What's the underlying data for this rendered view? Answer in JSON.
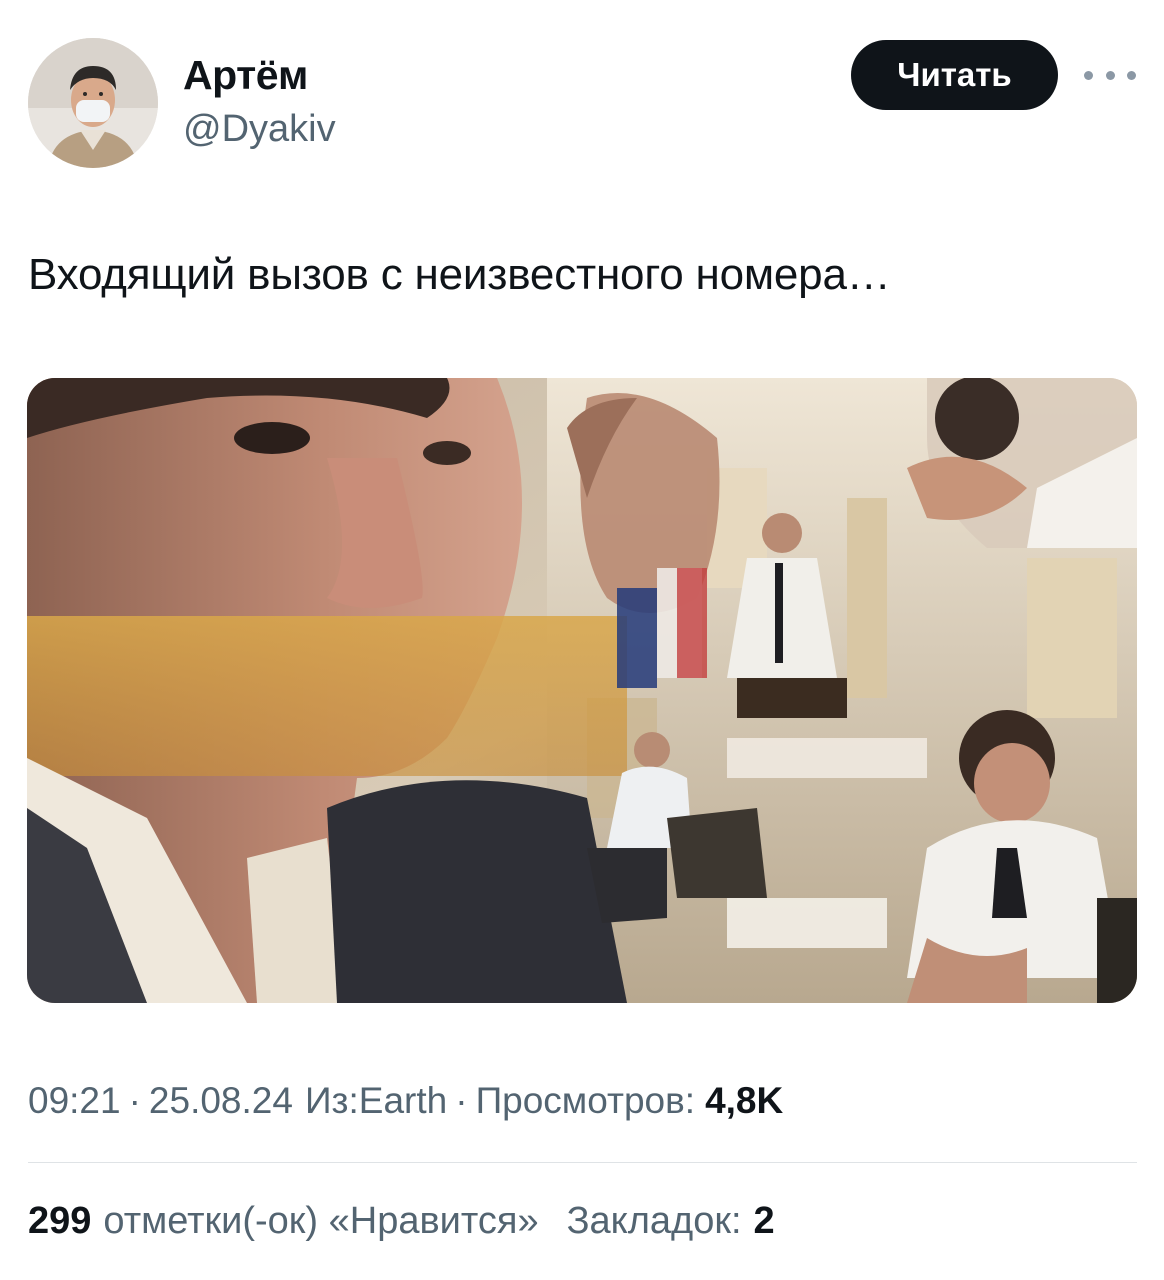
{
  "author": {
    "name": "Артём",
    "handle": "@Dyakiv"
  },
  "follow_button": {
    "label": "Читать"
  },
  "more_icon": "more-horizontal-icon",
  "tweet": {
    "text": "Входящий вызов с неизвестного номера…"
  },
  "meta": {
    "time": "09:21",
    "separator": "·",
    "date": "25.08.24",
    "source": "Из:Earth",
    "views_label": "Просмотров:",
    "views_count": "4,8K"
  },
  "stats": {
    "likes_count": "299",
    "likes_label": "отметки(-ок) «Нравится»",
    "bookmarks_label": "Закладок:",
    "bookmarks_count": "2"
  },
  "colors": {
    "text_primary": "#0f1419",
    "text_secondary": "#536471",
    "button_bg": "#0f1419",
    "divider": "#dfe3e6"
  }
}
